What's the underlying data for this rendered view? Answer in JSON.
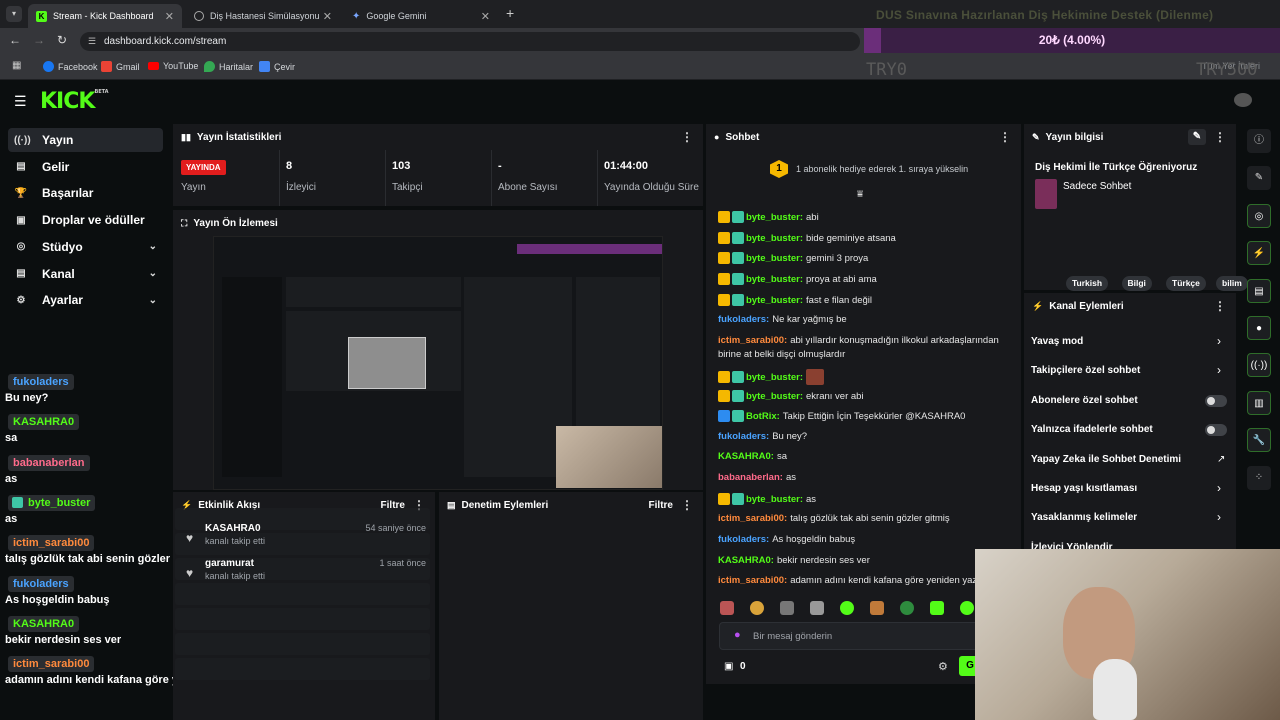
{
  "browser": {
    "tabs": [
      {
        "label": "Stream - Kick Dashboard",
        "active": true
      },
      {
        "label": "Diş Hastanesi Simülasyonu",
        "active": false
      },
      {
        "label": "Google Gemini",
        "active": false
      }
    ],
    "url": "dashboard.kick.com/stream",
    "bookmarks": [
      "Facebook",
      "Gmail",
      "YouTube",
      "Haritalar",
      "Çevir"
    ]
  },
  "overlay": {
    "goal_title": "DUS Sınavına Hazırlanan Diş Hekimine Destek (Dilenme) ",
    "goal_text": "20₺ (4.00%)",
    "goal_progress": 0.04,
    "goal_min": "TRY0",
    "goal_max": "TRY500",
    "bookmarks_more": "Tüm Yer İmleri"
  },
  "app": {
    "logo": "KICK",
    "logo_beta": "BETA",
    "sidebar": [
      {
        "label": "Yayın",
        "icon": "broadcast-icon",
        "active": true,
        "expand": false
      },
      {
        "label": "Gelir",
        "icon": "revenue-icon",
        "active": false,
        "expand": false
      },
      {
        "label": "Başarılar",
        "icon": "trophy-icon",
        "active": false,
        "expand": false
      },
      {
        "label": "Droplar ve ödüller",
        "icon": "gift-icon",
        "active": false,
        "expand": false
      },
      {
        "label": "Stüdyo",
        "icon": "studio-icon",
        "active": false,
        "expand": true
      },
      {
        "label": "Kanal",
        "icon": "channel-icon",
        "active": false,
        "expand": true
      },
      {
        "label": "Ayarlar",
        "icon": "settings-icon",
        "active": false,
        "expand": true
      }
    ],
    "overlay_chat": [
      {
        "name": "fukoladers",
        "color": "#4aa3ff",
        "text": "Bu ney?"
      },
      {
        "name": "KASAHRA0",
        "color": "#53fc18",
        "text": "sa"
      },
      {
        "name": "babanaberlan",
        "color": "#ff6b8b",
        "text": "as"
      },
      {
        "name": "byte_buster",
        "color": "#53fc18",
        "text": "as"
      },
      {
        "name": "ictim_sarabi00",
        "color": "#ff8a3d",
        "text": "talış gözlük tak abi senin gözler gitmiş"
      },
      {
        "name": "fukoladers",
        "color": "#4aa3ff",
        "text": "As hoşgeldin babuş"
      },
      {
        "name": "KASAHRA0",
        "color": "#53fc18",
        "text": "bekir nerdesin ses ver"
      },
      {
        "name": "ictim_sarabi00",
        "color": "#ff8a3d",
        "text": "adamın adını kendi kafana göre yeniden yazdın **"
      }
    ],
    "stats": {
      "title": "Yayın İstatistikleri",
      "live_label": "YAYINDA",
      "live_caption": "Yayın",
      "cells": [
        {
          "value": "8",
          "label": "İzleyici"
        },
        {
          "value": "103",
          "label": "Takipçi"
        },
        {
          "value": "-",
          "label": "Abone Sayısı"
        },
        {
          "value": "01:44:00",
          "label": "Yayında Olduğu Süre"
        }
      ]
    },
    "preview_title": "Yayın Ön İzlemesi",
    "activity": {
      "title": "Etkinlik Akışı",
      "filter": "Filtre",
      "events": [
        {
          "user": "KASAHRA0",
          "action": "kanalı takip etti",
          "time": "54 saniye önce"
        },
        {
          "user": "garamurat",
          "action": "kanalı takip etti",
          "time": "1 saat önce"
        }
      ]
    },
    "moderation": {
      "title": "Denetim Eylemleri",
      "filter": "Filtre"
    },
    "chat": {
      "title": "Sohbet",
      "gift_banner": "1 abonelik hediye ederek 1. sıraya yükselin",
      "gift_count": "1",
      "messages": [
        {
          "name": "byte_buster",
          "color": "#53fc18",
          "badges": true,
          "text": "abi"
        },
        {
          "name": "byte_buster",
          "color": "#53fc18",
          "badges": true,
          "text": "bide geminiye atsana"
        },
        {
          "name": "byte_buster",
          "color": "#53fc18",
          "badges": true,
          "text": "gemini 3 proya"
        },
        {
          "name": "byte_buster",
          "color": "#53fc18",
          "badges": true,
          "text": "proya at abi ama"
        },
        {
          "name": "byte_buster",
          "color": "#53fc18",
          "badges": true,
          "text": "fast e filan değil"
        },
        {
          "name": "fukoladers",
          "color": "#4aa3ff",
          "badges": false,
          "text": "Ne kar yağmış be"
        },
        {
          "name": "ictim_sarabi00",
          "color": "#ff8a3d",
          "badges": false,
          "text": "abi yıllardır konuşmadığın ilkokul arkadaşlarından"
        },
        {
          "name": "",
          "color": "#e6e6e6",
          "badges": false,
          "text": "birine at belki dişçi olmuşlardır"
        },
        {
          "name": "byte_buster",
          "color": "#53fc18",
          "badges": true,
          "text": ""
        },
        {
          "name": "byte_buster",
          "color": "#53fc18",
          "badges": true,
          "text": "ekranı ver abi"
        },
        {
          "name": "BotRix",
          "color": "#53fc18",
          "badges": true,
          "text": "Takip Ettiğin İçin Teşekkürler @KASAHRA0"
        },
        {
          "name": "fukoladers",
          "color": "#4aa3ff",
          "badges": false,
          "text": "Bu ney?"
        },
        {
          "name": "KASAHRA0",
          "color": "#53fc18",
          "badges": false,
          "text": "sa"
        },
        {
          "name": "babanaberlan",
          "color": "#ff6b8b",
          "badges": false,
          "text": "as"
        },
        {
          "name": "byte_buster",
          "color": "#53fc18",
          "badges": true,
          "text": "as"
        },
        {
          "name": "ictim_sarabi00",
          "color": "#ff8a3d",
          "badges": false,
          "text": "talış gözlük tak abi senin gözler gitmiş"
        },
        {
          "name": "fukoladers",
          "color": "#4aa3ff",
          "badges": false,
          "text": "As hoşgeldin babuş"
        },
        {
          "name": "KASAHRA0",
          "color": "#53fc18",
          "badges": false,
          "text": "bekir nerdesin ses ver"
        },
        {
          "name": "ictim_sarabi00",
          "color": "#ff8a3d",
          "badges": false,
          "text": "adamın adını kendi kafana göre yeniden yazdın"
        }
      ],
      "input_placeholder": "Bir mesaj gönderin",
      "points": "0",
      "send_label": "G"
    },
    "stream_info": {
      "title": "Yayın bilgisi",
      "stream_title": "Diş Hekimi İle Türkçe Öğreniyoruz",
      "category": "Sadece Sohbet",
      "tags": [
        "Turkish",
        "Bilgi",
        "Türkçe",
        "bilim"
      ]
    },
    "channel_actions": {
      "title": "Kanal Eylemleri",
      "items": [
        {
          "label": "Yavaş mod",
          "control": "chevron"
        },
        {
          "label": "Takipçilere özel sohbet",
          "control": "chevron"
        },
        {
          "label": "Abonelere özel sohbet",
          "control": "toggle"
        },
        {
          "label": "Yalnızca ifadelerle sohbet",
          "control": "toggle"
        },
        {
          "label": "Yapay Zeka ile Sohbet Denetimi",
          "control": "external"
        },
        {
          "label": "Hesap yaşı kısıtlaması",
          "control": "chevron"
        },
        {
          "label": "Yasaklanmış kelimeler",
          "control": "chevron"
        },
        {
          "label": "İzleyici Yönlendir",
          "control": "none"
        }
      ]
    }
  }
}
